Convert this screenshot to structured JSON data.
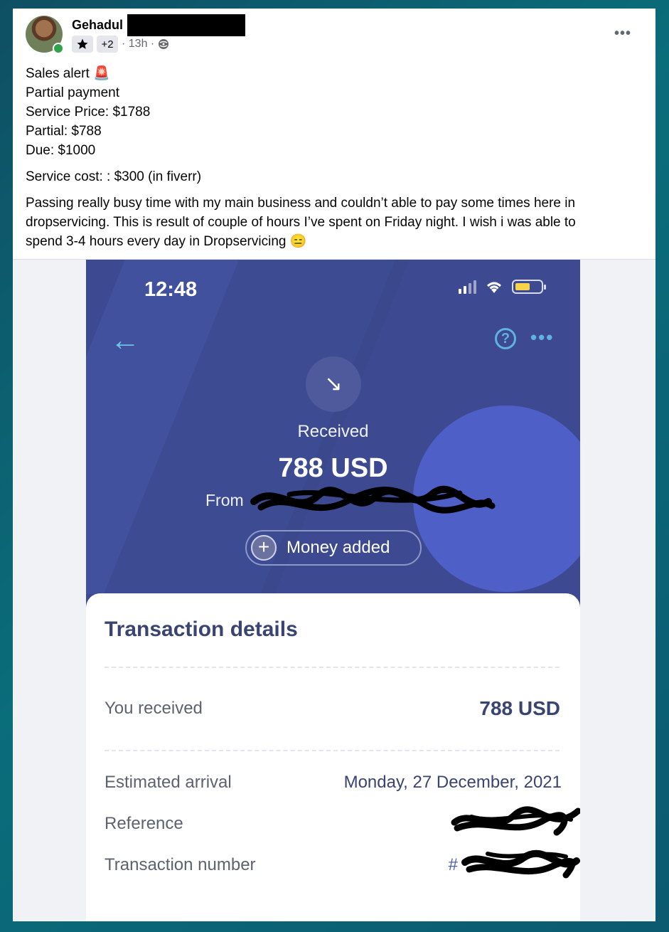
{
  "post": {
    "author": "Gehadul",
    "badge_icon": "star-icon",
    "badge_count": "+2",
    "time": "· 13h ·",
    "privacy_icon": "globe-icon",
    "more_label": "•••",
    "lines": [
      "Sales alert 🚨",
      "Partial payment",
      "Service Price: $1788",
      "Partial: $788",
      "Due: $1000"
    ],
    "cost_line": "Service cost: : $300 (in fiverr)",
    "paragraph_lines": [
      "Passing really busy time with my main business and couldn’t able to pay some times here in",
      "dropservicing. This is result of couple of hours I’ve spent on Friday night. I wish i was able to",
      "spend 3-4 hours every day in Dropservicing 😑"
    ]
  },
  "screenshot": {
    "clock": "12:48",
    "back_icon": "←",
    "help_icon": "?",
    "menu_icon": "•••",
    "received_icon": "↘",
    "received_label": "Received",
    "amount": "788 USD",
    "from_label": "From",
    "money_added_icon": "+",
    "money_added_label": "Money added",
    "details": {
      "title": "Transaction details",
      "you_received_label": "You received",
      "you_received_value": "788 USD",
      "estimated_arrival_label": "Estimated arrival",
      "estimated_arrival_value": "Monday, 27 December, 2021",
      "reference_label": "Reference",
      "transaction_number_label": "Transaction number",
      "transaction_number_prefix": "#"
    }
  },
  "colors": {
    "phone_bg": "#3d4a91",
    "accent_blue": "#5fb3de",
    "details_title": "#3a4470",
    "online": "#31a24c"
  }
}
